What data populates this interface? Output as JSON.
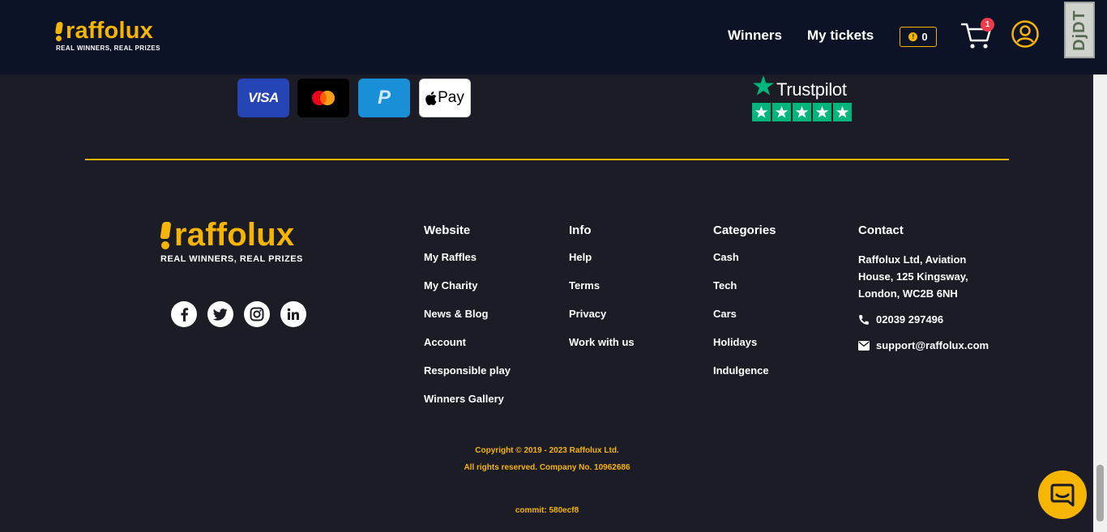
{
  "header": {
    "logo": {
      "name": "raffolux",
      "tagline": "REAL WINNERS, REAL PRIZES"
    },
    "nav": {
      "winners": "Winners",
      "my_tickets": "My tickets"
    },
    "coins": "0",
    "cart_count": "1",
    "debug_toolbar": "DjDT"
  },
  "payments": {
    "visa": "VISA",
    "mastercard": "Mastercard",
    "paypal": "P",
    "applepay": "Pay"
  },
  "trustpilot": {
    "name": "Trustpilot",
    "stars": 5
  },
  "footer": {
    "logo": {
      "name": "raffolux",
      "tagline": "REAL WINNERS, REAL PRIZES"
    },
    "socials": [
      "facebook-icon",
      "twitter-icon",
      "instagram-icon",
      "linkedin-icon"
    ],
    "columns": {
      "website": {
        "title": "Website",
        "items": [
          "My Raffles",
          "My Charity",
          "News & Blog",
          "Account",
          "Responsible play",
          "Winners Gallery"
        ]
      },
      "info": {
        "title": "Info",
        "items": [
          "Help",
          "Terms",
          "Privacy",
          "Work with us"
        ]
      },
      "categories": {
        "title": "Categories",
        "items": [
          "Cash",
          "Tech",
          "Cars",
          "Holidays",
          "Indulgence"
        ]
      },
      "contact": {
        "title": "Contact",
        "address": "Raffolux Ltd, Aviation House, 125 Kingsway, London, WC2B 6NH",
        "phone": "02039 297496",
        "email": "support@raffolux.com"
      }
    },
    "copyright_1": "Copyright © 2019 - 2023 Raffolux Ltd.",
    "copyright_2": "All rights reserved. Company No. 10962686",
    "commit": "commit: 580ecf8"
  },
  "colors": {
    "accent": "#f5b500",
    "header_bg": "#0d1326",
    "page_bg": "#1b1c26",
    "trustpilot": "#00b67a",
    "badge": "#ef3b4a"
  }
}
